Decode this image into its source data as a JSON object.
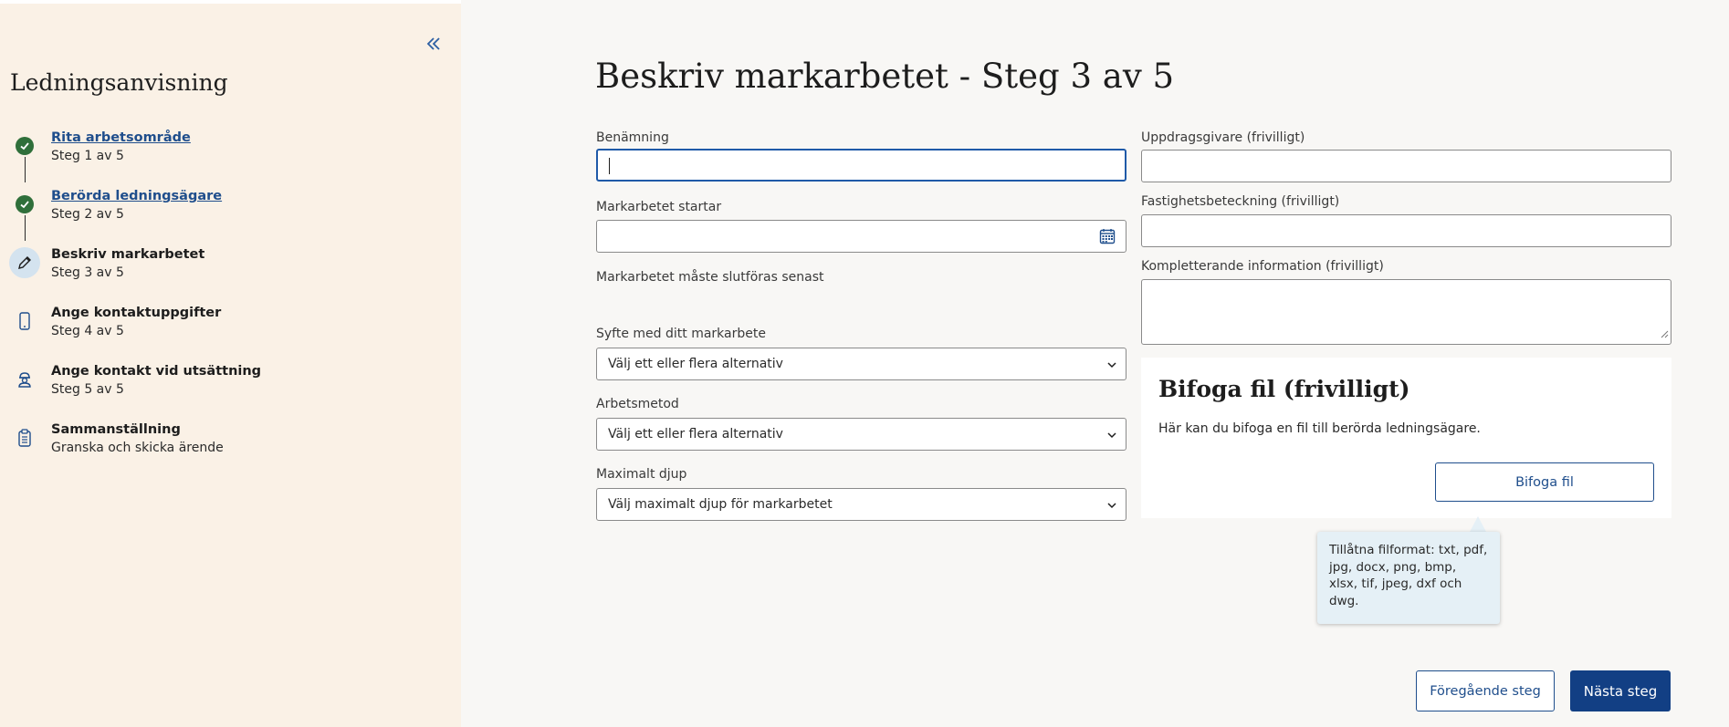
{
  "sidebar": {
    "title": "Ledningsanvisning",
    "steps": [
      {
        "title": "Rita arbetsområde",
        "sub": "Steg 1 av 5",
        "state": "done",
        "icon": "check-icon"
      },
      {
        "title": "Berörda ledningsägare",
        "sub": "Steg 2 av 5",
        "state": "done",
        "icon": "check-icon"
      },
      {
        "title": "Beskriv markarbetet",
        "sub": "Steg 3 av 5",
        "state": "current",
        "icon": "pencil-icon"
      },
      {
        "title": "Ange kontaktuppgifter",
        "sub": "Steg 4 av 5",
        "state": "todo",
        "icon": "phone-icon"
      },
      {
        "title": "Ange kontakt vid utsättning",
        "sub": "Steg 5 av 5",
        "state": "todo",
        "icon": "worker-icon"
      },
      {
        "title": "Sammanställning",
        "sub": "Granska och skicka ärende",
        "state": "todo",
        "icon": "clipboard-icon"
      }
    ]
  },
  "main": {
    "title": "Beskriv markarbetet - Steg 3 av 5",
    "left": {
      "benamning_label": "Benämning",
      "benamning_value": "",
      "start_label": "Markarbetet startar",
      "start_value": "",
      "deadline_label": "Markarbetet måste slutföras senast",
      "syfte_label": "Syfte med ditt markarbete",
      "syfte_value": "Välj ett eller flera alternativ",
      "metod_label": "Arbetsmetod",
      "metod_value": "Välj ett eller flera alternativ",
      "djup_label": "Maximalt djup",
      "djup_value": "Välj maximalt djup för markarbetet"
    },
    "right": {
      "uppdragsgivare_label": "Uppdragsgivare (frivilligt)",
      "fastighet_label": "Fastighetsbeteckning (frivilligt)",
      "komplettering_label": "Kompletterande information (frivilligt)"
    },
    "attach": {
      "title": "Bifoga fil (frivilligt)",
      "description": "Här kan du bifoga en fil till berörda ledningsägare.",
      "button": "Bifoga fil",
      "tooltip": "Tillåtna filformat: txt, pdf, jpg, docx, png, bmp, xlsx, tif, jpeg, dxf och dwg."
    },
    "nav": {
      "prev": "Föregående steg",
      "next": "Nästa steg"
    }
  },
  "colors": {
    "sidebar_bg": "#faf1e6",
    "primary": "#123f84",
    "link": "#1f4e8c",
    "done_green": "#2f6f3a",
    "tooltip_bg": "#e5f0f6"
  }
}
